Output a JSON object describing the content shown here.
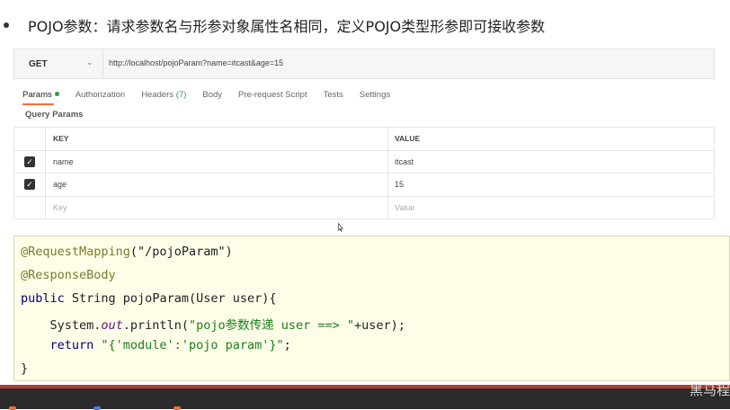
{
  "bullet": {
    "text": "POJO参数：请求参数名与形参对象属性名相同，定义POJO类型形参即可接收参数"
  },
  "request": {
    "method": "GET",
    "url": "http://localhost/pojoParam?name=itcast&age=15"
  },
  "tabs": [
    {
      "label": "Params"
    },
    {
      "label": "Authorization"
    },
    {
      "label": "Headers",
      "count": "(7)"
    },
    {
      "label": "Body"
    },
    {
      "label": "Pre-request Script"
    },
    {
      "label": "Tests"
    },
    {
      "label": "Settings"
    }
  ],
  "query_params": {
    "title": "Query Params",
    "headers": {
      "key": "KEY",
      "value": "VALUE"
    },
    "rows": [
      {
        "key": "name",
        "value": "itcast",
        "checked": true
      },
      {
        "key": "age",
        "value": "15",
        "checked": true
      }
    ],
    "placeholder": {
      "key": "Key",
      "value": "Value"
    }
  },
  "code": {
    "line1_annot": "@RequestMapping",
    "line1_rest": "(\"/pojoParam\")",
    "line2_annot": "@ResponseBody",
    "line3_kw": "public",
    "line3_rest": " String pojoParam(User user){",
    "line4_a": "    System.",
    "line4_out": "out",
    "line4_b": ".println(",
    "line4_str": "\"pojo参数传递 user ==> \"",
    "line4_c": "+user);",
    "line5_kw": "    return",
    "line5_str": " \"{'module':'pojo param'}\"",
    "line5_c": ";",
    "line6": "}"
  },
  "watermark": "黑马程"
}
